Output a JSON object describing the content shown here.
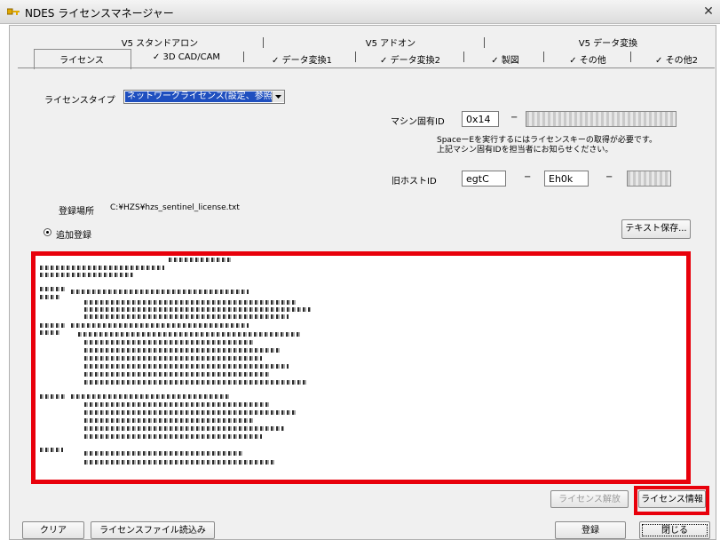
{
  "window": {
    "title": "NDES ライセンスマネージャー",
    "close_symbol": "✕"
  },
  "tabs_top": [
    {
      "label": "V5 スタンドアロン"
    },
    {
      "label": "V5 アドオン"
    },
    {
      "label": "V5 データ変換"
    }
  ],
  "tabs_bottom": [
    {
      "label": "ライセンス",
      "active": true
    },
    {
      "label": "✓ 3D CAD/CAM"
    },
    {
      "label": "✓ データ変換1"
    },
    {
      "label": "✓ データ変換2"
    },
    {
      "label": "✓ 製図"
    },
    {
      "label": "✓ その他"
    },
    {
      "label": "✓ その他2"
    }
  ],
  "license": {
    "type_label": "ライセンスタイプ",
    "type_value": "ネットワークライセンス(設定、参照)",
    "machine_id_label": "マシン固有ID",
    "machine_id_prefix": "0x14",
    "machine_id_dash": "−",
    "notice_line1": "SpaceーEを実行するにはライセンスキーの取得が必要です。",
    "notice_line2": "上記マシン固有IDを担当者にお知らせください。",
    "host_id_label": "旧ホストID",
    "host_id_1": "egtC",
    "host_id_2": "Eh0k",
    "host_id_dash": "−",
    "register_label": "登録場所",
    "register_path": "C:¥HZS¥hzs_sentinel_license.txt",
    "radio_label": "追加登録",
    "save_text_button": "テキスト保存...",
    "release_button": "ライセンス解放",
    "info_button": "ライセンス情報"
  },
  "footer": {
    "clear_button": "クリア",
    "load_button": "ライセンスファイル読込み",
    "register_button": "登録",
    "close_button": "閉じる"
  },
  "colors": {
    "highlight": "#e8000b",
    "selection": "#1f4fbf"
  }
}
